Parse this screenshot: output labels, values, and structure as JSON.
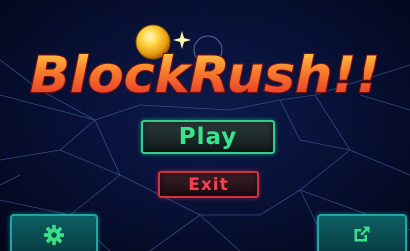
{
  "game": {
    "title": "BlockRush!!",
    "title_colors": {
      "fill_top": "#ffd84a",
      "fill_bottom": "#e8352a",
      "outline": "#7a0d10"
    }
  },
  "menu": {
    "play_label": "Play",
    "exit_label": "Exit"
  },
  "toolbar": {
    "settings_icon": "gear-icon",
    "share_icon": "external-link-icon"
  },
  "colors": {
    "background": "#081138",
    "play_accent": "#37e58a",
    "exit_accent": "#ff3d4e",
    "corner_button": "#0d5f63"
  }
}
